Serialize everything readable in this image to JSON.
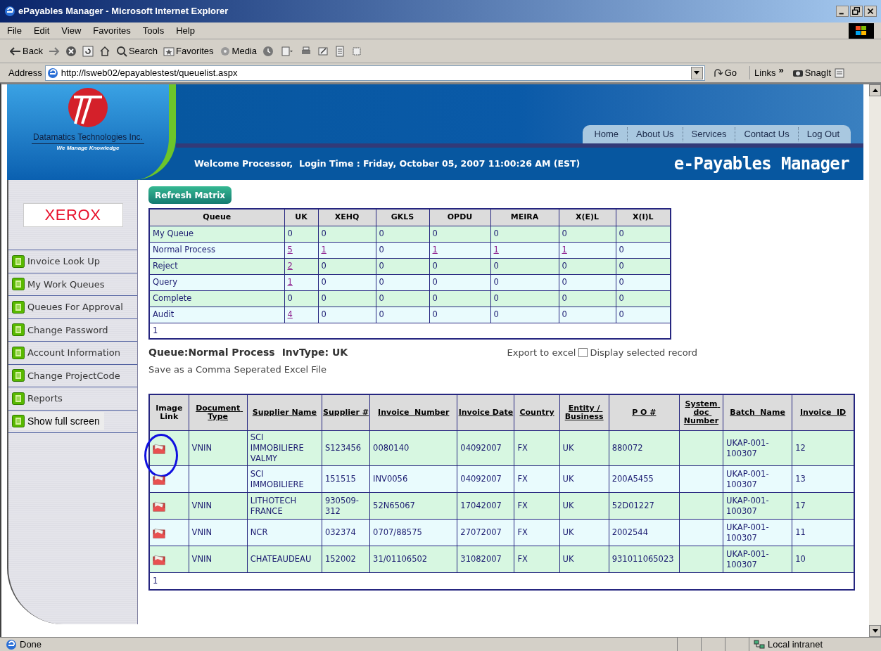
{
  "window": {
    "title": "ePayables Manager - Microsoft Internet Explorer"
  },
  "menu": [
    "File",
    "Edit",
    "View",
    "Favorites",
    "Tools",
    "Help"
  ],
  "toolbar": {
    "back": "Back",
    "search": "Search",
    "favorites": "Favorites",
    "media": "Media"
  },
  "address_bar": {
    "label": "Address",
    "value": "http://lsweb02/epayablestest/queuelist.aspx",
    "go": "Go",
    "links": "Links",
    "chevron": "»",
    "snagit": "SnagIt"
  },
  "header": {
    "company": "Datamatics Technologies Inc.",
    "tagline": "We Manage Knowledge",
    "nav": [
      "Home",
      "About Us",
      "Services",
      "Contact Us",
      "Log Out"
    ],
    "welcome": "Welcome Processor,  Login Time : Friday, October 05, 2007 11:00:26 AM (EST)",
    "product": "e-Payables Manager"
  },
  "sidebar": {
    "client": "XEROX",
    "items": [
      {
        "label": "Invoice Look Up",
        "selected": false
      },
      {
        "label": "My Work Queues",
        "selected": false
      },
      {
        "label": "Queues For Approval",
        "selected": false
      },
      {
        "label": "Change Password",
        "selected": false
      },
      {
        "label": "Account Information",
        "selected": false
      },
      {
        "label": "Change ProjectCode",
        "selected": false
      },
      {
        "label": "Reports",
        "selected": false
      },
      {
        "label": "Show full screen",
        "selected": true
      }
    ]
  },
  "refresh_button": "Refresh Matrix",
  "matrix": {
    "columns": [
      "Queue",
      "UK",
      "XEHQ",
      "GKLS",
      "OPDU",
      "MEIRA",
      "X(E)L",
      "X(I)L"
    ],
    "rows": [
      {
        "cells": [
          {
            "text": "My Queue",
            "link": false
          },
          {
            "text": "0",
            "link": false
          },
          {
            "text": "0",
            "link": false
          },
          {
            "text": "0",
            "link": false
          },
          {
            "text": "0",
            "link": false
          },
          {
            "text": "0",
            "link": false
          },
          {
            "text": "0",
            "link": false
          },
          {
            "text": "0",
            "link": false
          }
        ]
      },
      {
        "cells": [
          {
            "text": "Normal Process",
            "link": false
          },
          {
            "text": "5",
            "link": true
          },
          {
            "text": "1",
            "link": true
          },
          {
            "text": "0",
            "link": false
          },
          {
            "text": "1",
            "link": true
          },
          {
            "text": "1",
            "link": true
          },
          {
            "text": "1",
            "link": true
          },
          {
            "text": "0",
            "link": false
          }
        ]
      },
      {
        "cells": [
          {
            "text": "Reject",
            "link": false
          },
          {
            "text": "2",
            "link": true
          },
          {
            "text": "0",
            "link": false
          },
          {
            "text": "0",
            "link": false
          },
          {
            "text": "0",
            "link": false
          },
          {
            "text": "0",
            "link": false
          },
          {
            "text": "0",
            "link": false
          },
          {
            "text": "0",
            "link": false
          }
        ]
      },
      {
        "cells": [
          {
            "text": "Query",
            "link": false
          },
          {
            "text": "1",
            "link": true
          },
          {
            "text": "0",
            "link": false
          },
          {
            "text": "0",
            "link": false
          },
          {
            "text": "0",
            "link": false
          },
          {
            "text": "0",
            "link": false
          },
          {
            "text": "0",
            "link": false
          },
          {
            "text": "0",
            "link": false
          }
        ]
      },
      {
        "cells": [
          {
            "text": "Complete",
            "link": false
          },
          {
            "text": "0",
            "link": false
          },
          {
            "text": "0",
            "link": false
          },
          {
            "text": "0",
            "link": false
          },
          {
            "text": "0",
            "link": false
          },
          {
            "text": "0",
            "link": false
          },
          {
            "text": "0",
            "link": false
          },
          {
            "text": "0",
            "link": false
          }
        ]
      },
      {
        "cells": [
          {
            "text": "Audit",
            "link": false
          },
          {
            "text": "4",
            "link": true
          },
          {
            "text": "0",
            "link": false
          },
          {
            "text": "0",
            "link": false
          },
          {
            "text": "0",
            "link": false
          },
          {
            "text": "0",
            "link": false
          },
          {
            "text": "0",
            "link": false
          },
          {
            "text": "0",
            "link": false
          }
        ]
      }
    ],
    "page": "1"
  },
  "queue_info": {
    "queue": "Queue:Normal Process",
    "invtype": "InvType: UK",
    "export": "Export to excel",
    "display_selected": {
      "label": "Display selected record",
      "checked": false
    },
    "save_csv": "Save as a Comma Seperated Excel File"
  },
  "invoices": {
    "columns": [
      "Image Link",
      "Document Type",
      "Supplier Name",
      "Supplier #",
      "Invoice  Number",
      "Invoice Date",
      "Country",
      "Entity / Business",
      "P O #",
      "System doc Number",
      "Batch  Name",
      "Invoice  ID"
    ],
    "rows": [
      {
        "highlighted": true,
        "cells": [
          "",
          "VNIN",
          "SCI IMMOBILIERE VALMY",
          "S123456",
          "0080140",
          "04092007",
          "FX",
          "UK",
          "880072",
          "",
          "UKAP-001-100307",
          "12"
        ]
      },
      {
        "highlighted": false,
        "cells": [
          "",
          "",
          "SCI IMMOBILIERE",
          "151515",
          "INV0056",
          "04092007",
          "FX",
          "UK",
          "200A5455",
          "",
          "UKAP-001-100307",
          "13"
        ]
      },
      {
        "highlighted": false,
        "cells": [
          "",
          "VNIN",
          "LITHOTECH FRANCE",
          "930509-312",
          "52N65067",
          "17042007",
          "FX",
          "UK",
          "52D01227",
          "",
          "UKAP-001-100307",
          "17"
        ]
      },
      {
        "highlighted": false,
        "cells": [
          "",
          "VNIN",
          "NCR",
          "032374",
          "0707/88575",
          "27072007",
          "FX",
          "UK",
          "2002544",
          "",
          "UKAP-001-100307",
          "11"
        ]
      },
      {
        "highlighted": false,
        "cells": [
          "",
          "VNIN",
          "CHATEAUDEAU",
          "152002",
          "31/01106502",
          "31082007",
          "FX",
          "UK",
          "931011065023",
          "",
          "UKAP-001-100307",
          "10"
        ]
      }
    ],
    "page": "1"
  },
  "status_bar": {
    "text": "Done",
    "zone": "Local intranet"
  }
}
